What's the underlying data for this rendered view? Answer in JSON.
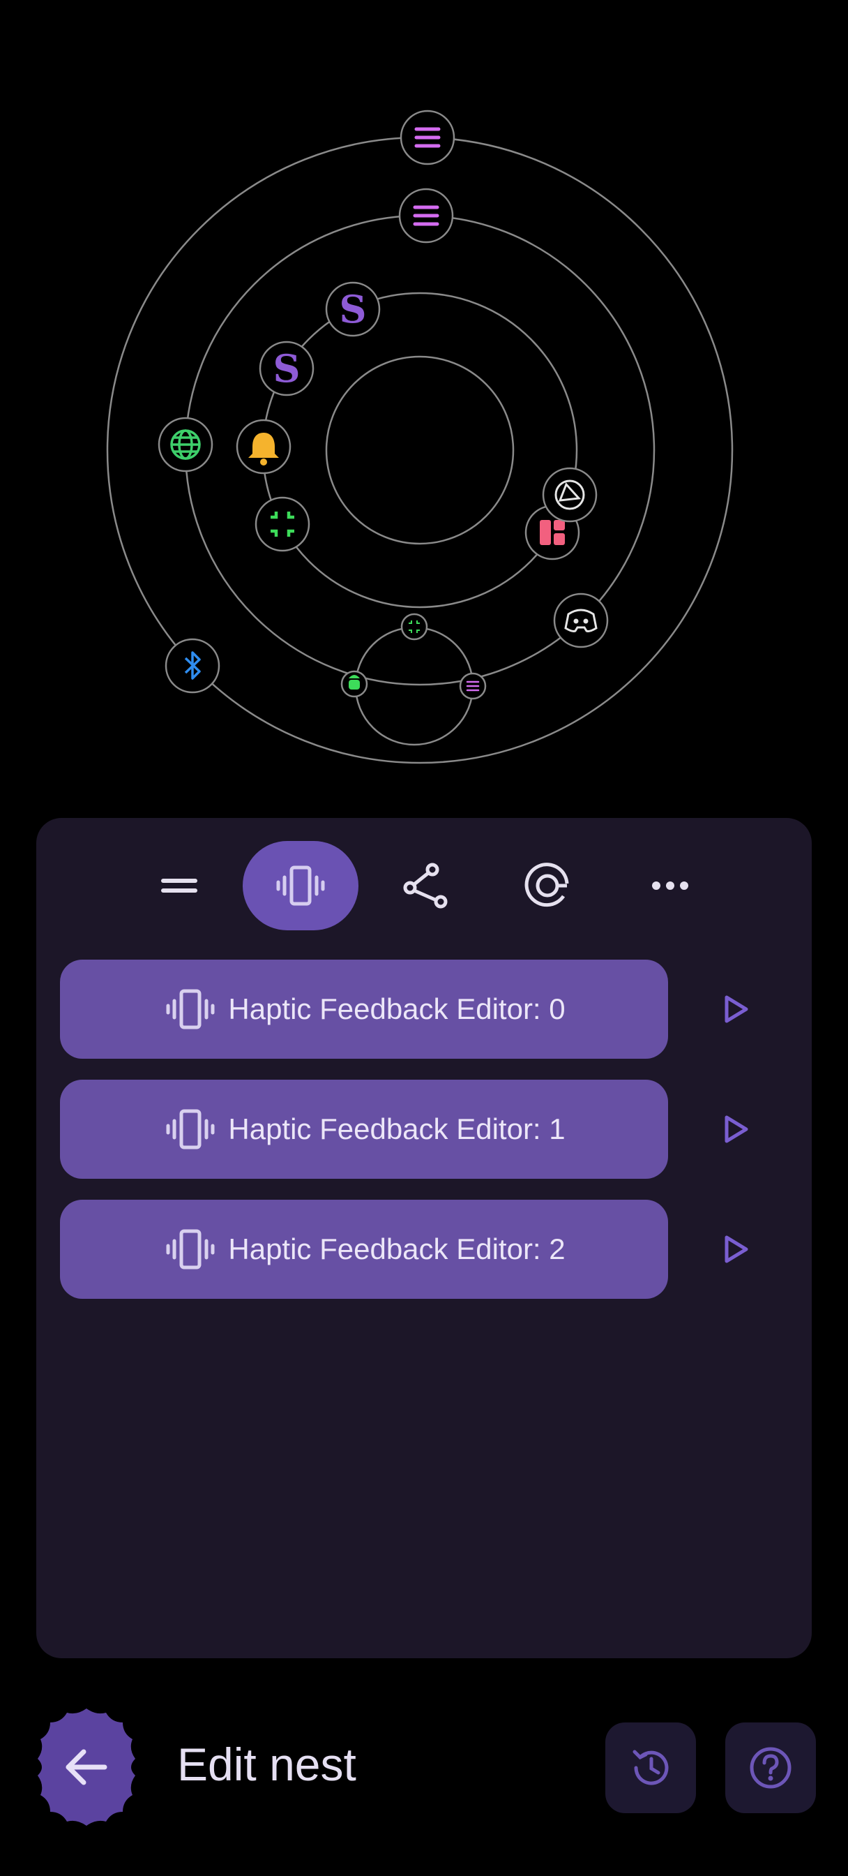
{
  "colors": {
    "background": "#000000",
    "panel": "#1c1628",
    "accent": "#6750a4",
    "active_tab": "#6a52b3",
    "orbit_line": "#8a8a8a"
  },
  "orbit_icons": [
    "menu-icon",
    "menu-icon",
    "dragon-icon",
    "dragon-icon",
    "globe-icon",
    "bell-icon",
    "fullscreen-exit-icon",
    "network-icon",
    "dashboard-icon",
    "discord-icon",
    "bluetooth-icon",
    "android-icon",
    "fullscreen-exit-icon",
    "menu-icon"
  ],
  "tabs": [
    {
      "name": "tab-menu",
      "icon": "equals-icon"
    },
    {
      "name": "tab-haptic",
      "icon": "vibrate-icon",
      "active": true
    },
    {
      "name": "tab-share",
      "icon": "share-icon"
    },
    {
      "name": "tab-target",
      "icon": "target-icon"
    },
    {
      "name": "tab-more",
      "icon": "more-horizontal-icon"
    }
  ],
  "rows": [
    {
      "label": "Haptic Feedback Editor: 0",
      "icon": "vibrate-icon",
      "action_icon": "play-icon"
    },
    {
      "label": "Haptic Feedback Editor: 1",
      "icon": "vibrate-icon",
      "action_icon": "play-icon"
    },
    {
      "label": "Haptic Feedback Editor: 2",
      "icon": "vibrate-icon",
      "action_icon": "play-icon"
    }
  ],
  "footer": {
    "title": "Edit nest",
    "back_icon": "arrow-left-icon",
    "history_icon": "history-icon",
    "help_icon": "help-icon"
  }
}
